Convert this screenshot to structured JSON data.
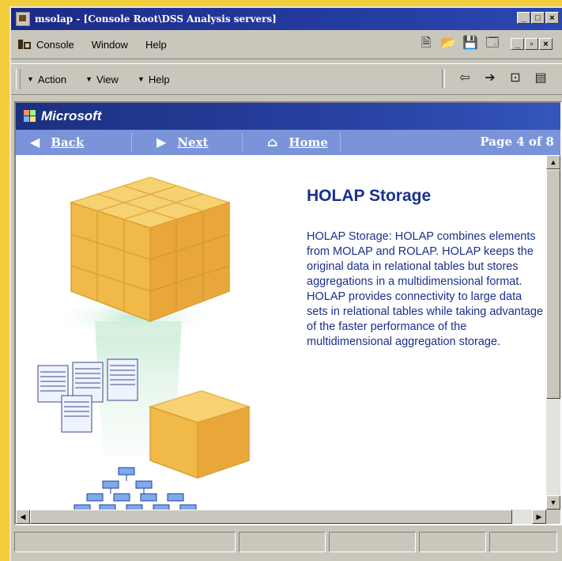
{
  "window": {
    "title": "msolap - [Console Root\\DSS Analysis servers]",
    "buttons": [
      "_",
      "□",
      "×"
    ]
  },
  "menubar": {
    "items": [
      "Console",
      "Window",
      "Help"
    ],
    "mdi_buttons": [
      "_",
      "▫",
      "×"
    ]
  },
  "toolbar": {
    "dropdowns": [
      "Action",
      "View",
      "Help"
    ]
  },
  "page": {
    "brand": "Microsoft",
    "nav": {
      "back": "Back",
      "next": "Next",
      "home": "Home",
      "page_count": "Page 4 of 8"
    },
    "heading": "HOLAP Storage",
    "body": "HOLAP Storage: HOLAP combines elements from MOLAP and ROLAP. HOLAP keeps the original data in relational tables but stores aggregations in a multidimensional format. HOLAP provides connectivity to large data sets in relational tables while taking advantage of the faster performance of the multidimensional aggregation storage."
  },
  "colors": {
    "background": "#f2cd3c",
    "title_bar": "#1d2a86",
    "nav_bar": "#7b94d9",
    "heading": "#1a2f8e",
    "cube": "#f0b948"
  }
}
